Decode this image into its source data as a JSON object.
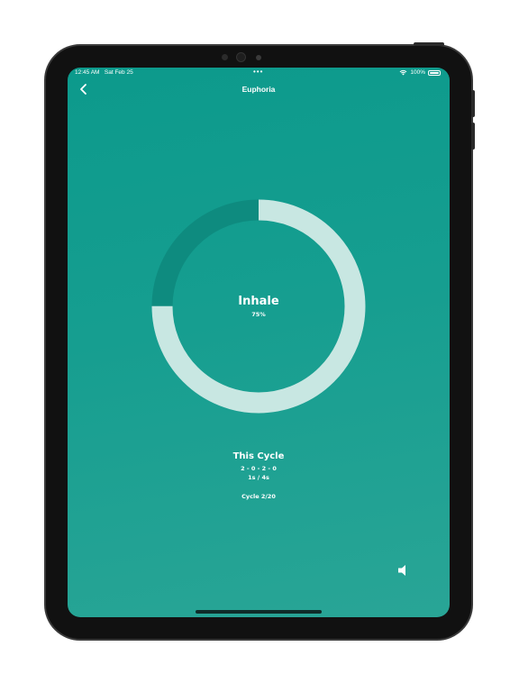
{
  "status_bar": {
    "time": "12:45 AM",
    "date": "Sat Feb 25",
    "dots": "•••",
    "battery": "100%"
  },
  "nav": {
    "title": "Euphoria",
    "back_icon": "chevron-left-icon"
  },
  "breathing": {
    "phase": "Inhale",
    "percent": "75%",
    "progress": 0.75
  },
  "cycle": {
    "title": "This Cycle",
    "pattern": "2 - 0 - 2 - 0",
    "time": "1s / 4s",
    "count": "Cycle 2/20"
  },
  "controls": {
    "sound_icon": "speaker-icon"
  },
  "colors": {
    "background_top": "#0c9a8c",
    "background_bottom": "#29a596",
    "ring_track": "#0e8b7f",
    "ring_progress": "#d3ece8",
    "text": "#ffffff"
  }
}
